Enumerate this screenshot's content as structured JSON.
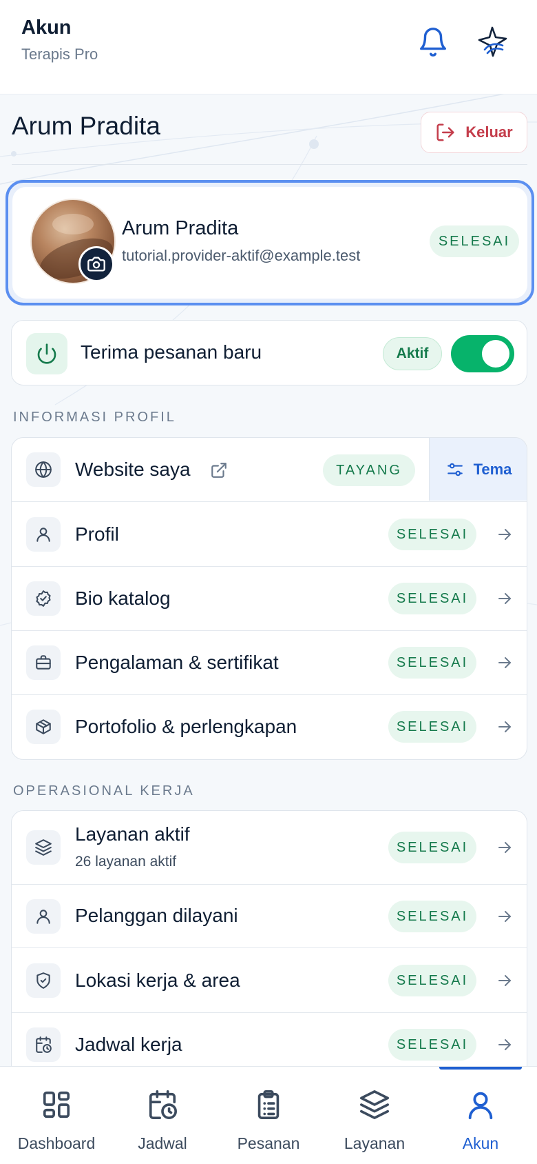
{
  "header": {
    "title": "Akun",
    "subtitle": "Terapis Pro"
  },
  "profile": {
    "heading": "Arum Pradita",
    "logout_label": "Keluar",
    "name": "Arum Pradita",
    "email": "tutorial.provider-aktif@example.test",
    "status": "SELESAI"
  },
  "accept_orders": {
    "label": "Terima pesanan baru",
    "status": "Aktif",
    "enabled": true
  },
  "sections": {
    "profile_info": {
      "title": "INFORMASI PROFIL",
      "website": {
        "label": "Website saya",
        "status": "TAYANG",
        "theme_label": "Tema"
      },
      "items": [
        {
          "label": "Profil",
          "status": "SELESAI",
          "icon": "user-icon"
        },
        {
          "label": "Bio katalog",
          "status": "SELESAI",
          "icon": "badge-check-icon"
        },
        {
          "label": "Pengalaman & sertifikat",
          "status": "SELESAI",
          "icon": "briefcase-icon"
        },
        {
          "label": "Portofolio & perlengkapan",
          "status": "SELESAI",
          "icon": "package-icon"
        }
      ]
    },
    "operations": {
      "title": "OPERASIONAL KERJA",
      "items": [
        {
          "label": "Layanan aktif",
          "sublabel": "26 layanan aktif",
          "status": "SELESAI",
          "icon": "layers-icon"
        },
        {
          "label": "Pelanggan dilayani",
          "status": "SELESAI",
          "icon": "user-icon"
        },
        {
          "label": "Lokasi kerja & area",
          "status": "SELESAI",
          "icon": "shield-check-icon"
        },
        {
          "label": "Jadwal kerja",
          "status": "SELESAI",
          "icon": "calendar-clock-icon"
        }
      ]
    }
  },
  "bottom_nav": {
    "items": [
      {
        "label": "Dashboard",
        "icon": "grid-icon"
      },
      {
        "label": "Jadwal",
        "icon": "calendar-clock-icon"
      },
      {
        "label": "Pesanan",
        "icon": "clipboard-list-icon"
      },
      {
        "label": "Layanan",
        "icon": "layers-icon"
      },
      {
        "label": "Akun",
        "icon": "user-icon",
        "active": true
      }
    ]
  },
  "colors": {
    "accent": "#1f5fd1",
    "success": "#157a4c",
    "success_bg": "#e7f6ee",
    "danger": "#c43d4b",
    "toggle_on": "#07b36b"
  }
}
